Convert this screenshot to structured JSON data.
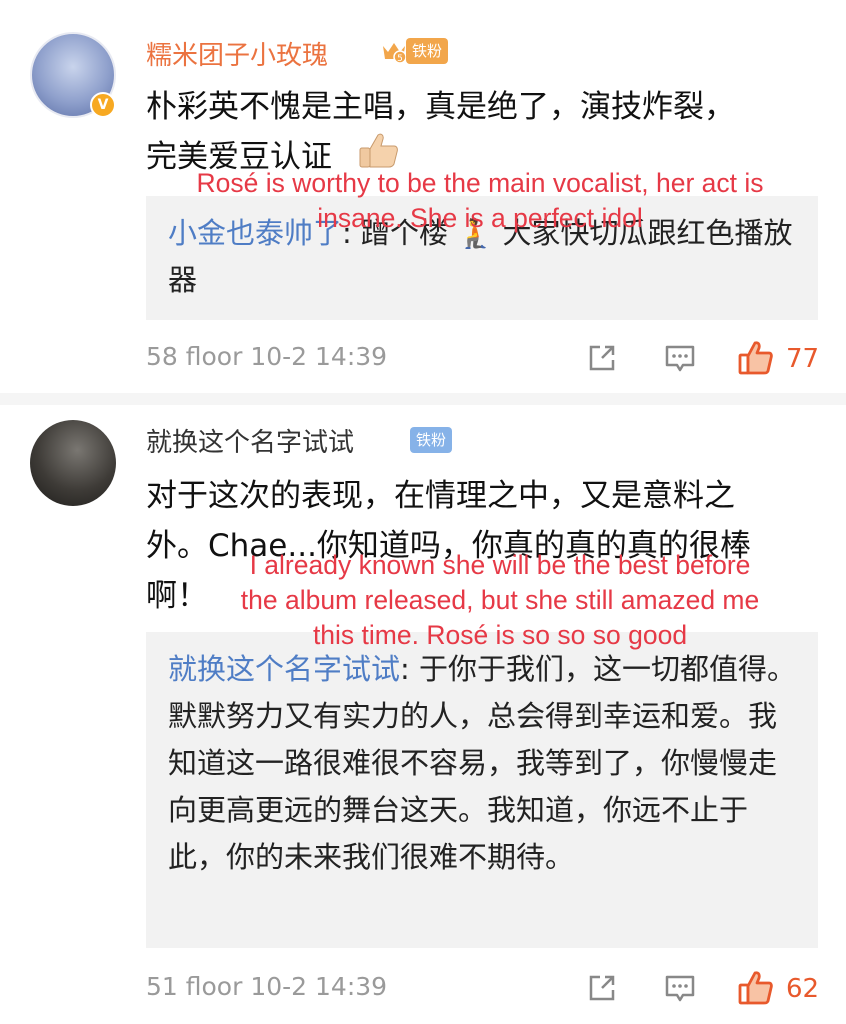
{
  "comments": [
    {
      "username": "糯米团子小玫瑰",
      "badge": "铁粉",
      "body_lines": [
        "朴彩英不愧是主唱，真是绝了，演技炸裂，",
        "完美爱豆认证"
      ],
      "reply_name": "小金也泰帅了",
      "reply_text": ": 蹭个楼 🧎 大家快切瓜跟红色播放器",
      "overlay": "Rosé is worthy to be the main vocalist, her act is\ninsane. She is a perfect idol",
      "meta": "58 floor 10-2 14:39",
      "likes": "77"
    },
    {
      "username": "就换这个名字试试",
      "badge": "铁粉",
      "body_lines": [
        "对于这次的表现，在情理之中，又是意料之",
        "外。Chae...你知道吗，你真的真的真的很棒",
        "啊！"
      ],
      "reply_name": "就换这个名字试试",
      "reply_text": ": 于你于我们，这一切都值得。默默努力又有实力的人，总会得到幸运和爱。我知道这一路很难很不容易，我等到了，你慢慢走向更高更远的舞台这天。我知道，你远不止于此，你的未来我们很难不期待。",
      "overlay": "I already known she will be the best before\nthe album released, but she still amazed me\nthis time. Rosé is so so so good",
      "meta": "51 floor 10-2 14:39",
      "likes": "62"
    }
  ],
  "icons": {
    "repost": "share-box-icon",
    "comment": "comment-bubble-icon",
    "like": "thumbs-up-icon",
    "verified": "verified-v-icon",
    "crown": "crown-fan-icon"
  },
  "colors": {
    "username_vip": "#eb7340",
    "reply_name": "#4f7dc5",
    "like": "#e8592c",
    "overlay": "#e63946"
  }
}
